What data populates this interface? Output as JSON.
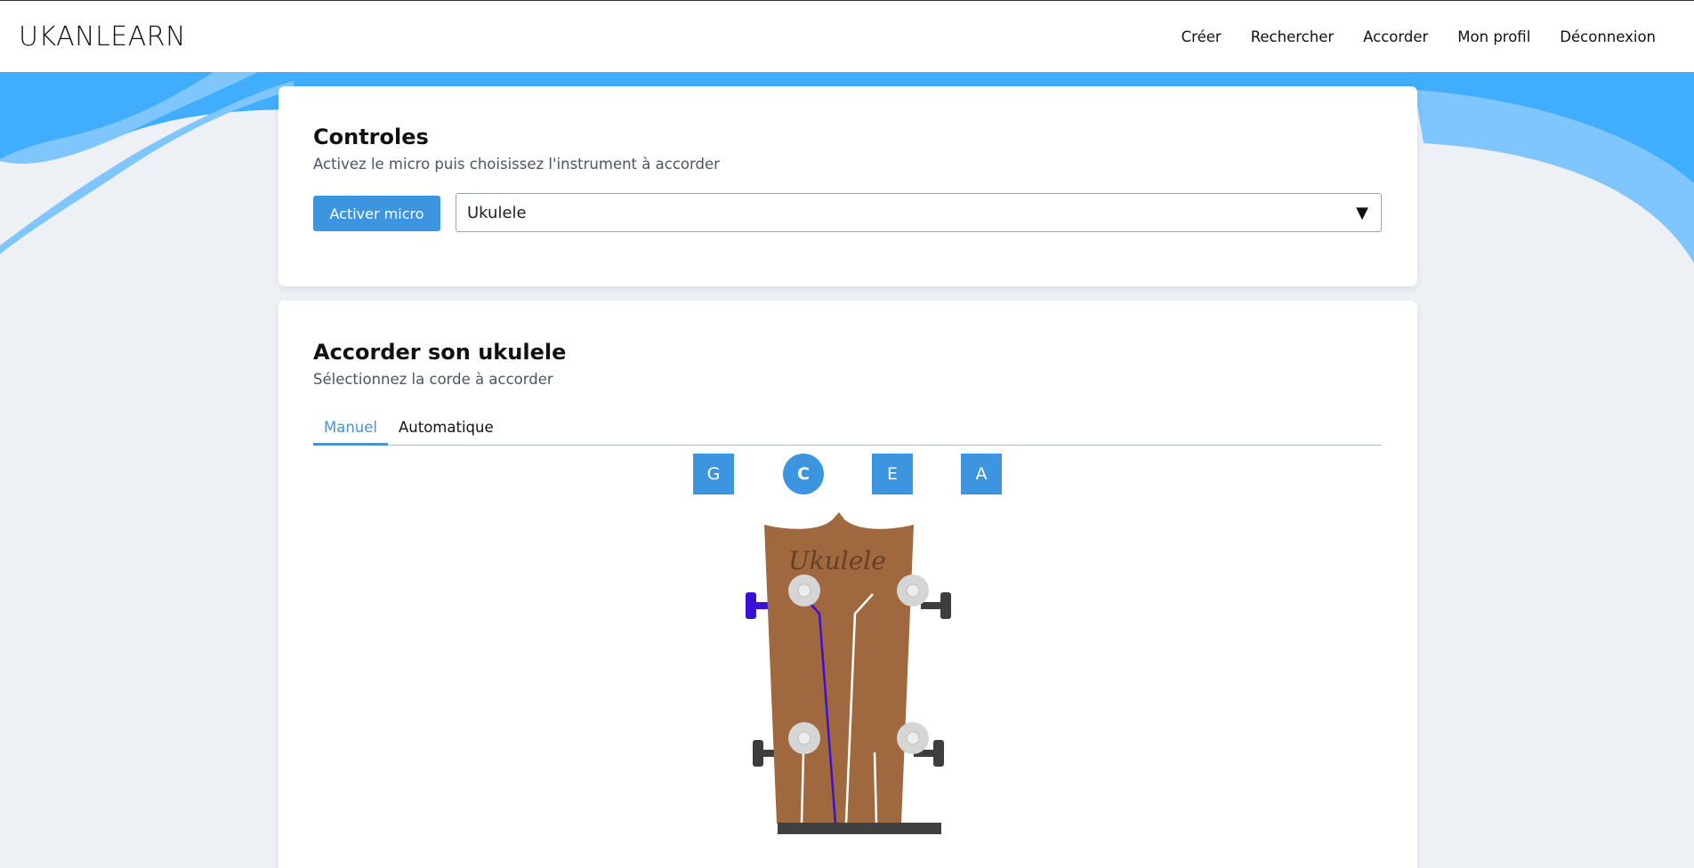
{
  "brand": "UKANLEARN",
  "nav": [
    "Créer",
    "Rechercher",
    "Accorder",
    "Mon profil",
    "Déconnexion"
  ],
  "controls": {
    "title": "Controles",
    "subtitle": "Activez le micro puis choisissez l'instrument à accorder",
    "mic_button": "Activer micro",
    "instrument_selected": "Ukulele",
    "dropdown_arrow": "▼"
  },
  "tuner": {
    "title": "Accorder son ukulele",
    "subtitle": "Sélectionnez la corde à accorder",
    "tabs": [
      {
        "label": "Manuel",
        "active": true
      },
      {
        "label": "Automatique",
        "active": false
      }
    ],
    "strings": [
      {
        "note": "G",
        "selected": false
      },
      {
        "note": "C",
        "selected": true
      },
      {
        "note": "E",
        "selected": false
      },
      {
        "note": "A",
        "selected": false
      }
    ],
    "headstock_logo": "Ukulele"
  },
  "colors": {
    "primary": "#3d95e0",
    "selected_string": "#3a0fd6",
    "wood": "#a0683f",
    "wave_dark": "#40adff",
    "wave_light": "#7fc6ff",
    "page_bg": "#edf1f5"
  }
}
